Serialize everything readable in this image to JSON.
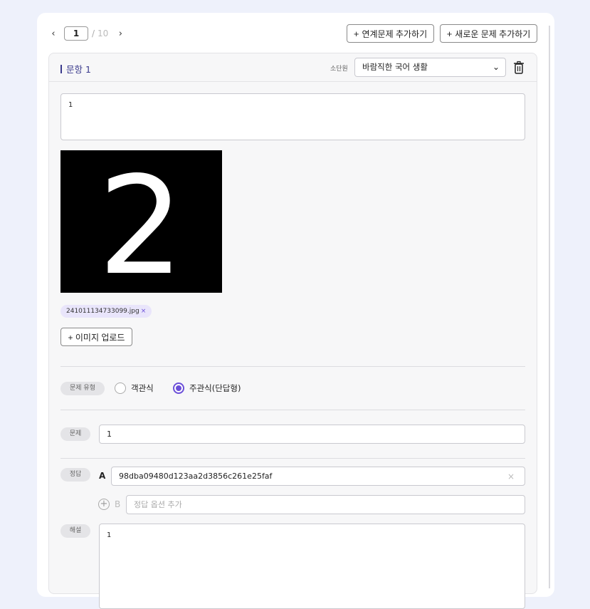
{
  "pager": {
    "current": "1",
    "separator": "/",
    "total": "10",
    "prev_icon": "chevron-left-icon",
    "next_icon": "chevron-right-icon"
  },
  "toolbar": {
    "plus": "+",
    "linked_label": "연계문제 추가하기",
    "new_label": "새로운 문제 추가하기"
  },
  "question": {
    "title": "문항 1",
    "unit_label": "소단원",
    "unit_value": "바람직한 국어 생활",
    "stem_text": "1",
    "image_digit": "2",
    "file_name": "241011134733099.jpg",
    "file_remove": "×",
    "upload_label": "+ 이미지 업로드"
  },
  "type_section": {
    "label": "문제 유형",
    "options": [
      "객관식",
      "주관식(단답형)"
    ],
    "selected": "주관식(단답형)"
  },
  "problem_section": {
    "label": "문제",
    "value": "1"
  },
  "answer_section": {
    "label": "정답",
    "answers": [
      {
        "letter": "A",
        "value": "98dba09480d123aa2d3856c261e25faf",
        "clear": "×"
      }
    ],
    "add_letter": "B",
    "add_placeholder": "정답 옵션 추가"
  },
  "explanation_section": {
    "label": "해설",
    "value": "1"
  },
  "colors": {
    "accent": "#6b4fd8",
    "title": "#3a3a8c",
    "background": "#eef1fb"
  }
}
